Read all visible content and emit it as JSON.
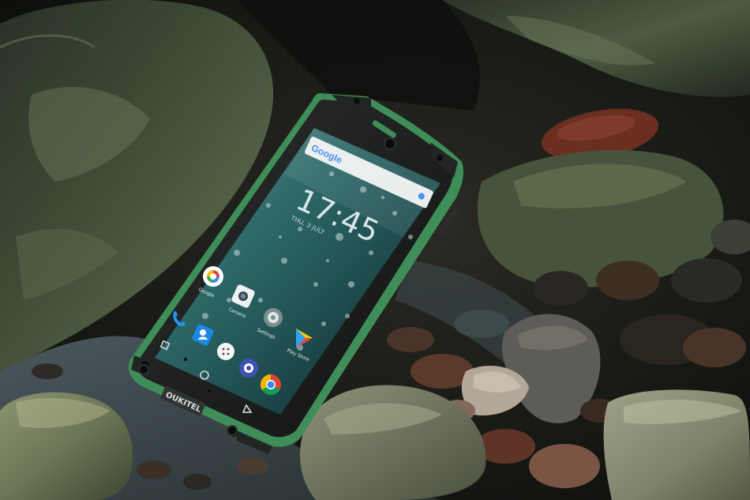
{
  "photo": {
    "brand_logo": "OUKITEL",
    "colors": {
      "rock_dark": "#1b211b",
      "rock_moss": "#4a5a3e",
      "phone_body": "#1a1c1b",
      "phone_accent": "#3f8e5a",
      "screen_bg": "#1d4a4c",
      "water": "#3b4a4e"
    }
  },
  "screen": {
    "search_bar": {
      "logo": "Google",
      "icon": "mic-icon"
    },
    "clock": {
      "time": "17:45",
      "date": "THU, 3 JULY"
    },
    "apps": [
      {
        "label": "Google",
        "icon": "google-app-icon"
      },
      {
        "label": "Camera",
        "icon": "camera-app-icon"
      },
      {
        "label": "Settings",
        "icon": "settings-app-icon"
      },
      {
        "label": "Play Store",
        "icon": "play-store-icon"
      }
    ],
    "dock": [
      {
        "icon": "phone-icon"
      },
      {
        "icon": "contacts-icon"
      },
      {
        "icon": "app-drawer-icon"
      },
      {
        "icon": "messages-icon"
      },
      {
        "icon": "chrome-icon"
      }
    ],
    "nav_buttons": [
      "recents-icon",
      "home-icon",
      "back-icon"
    ]
  }
}
